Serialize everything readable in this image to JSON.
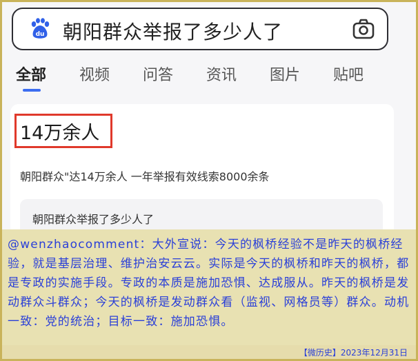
{
  "search": {
    "query": "朝阳群众举报了多少人了",
    "logo_icon": "baidu-paw-icon",
    "camera_icon": "camera-icon"
  },
  "tabs": [
    {
      "label": "全部",
      "active": true
    },
    {
      "label": "视频"
    },
    {
      "label": "问答"
    },
    {
      "label": "资讯"
    },
    {
      "label": "图片"
    },
    {
      "label": "贴吧"
    }
  ],
  "result": {
    "answer": "14万余人",
    "subtitle": "朝阳群众\"达14万余人 一年举报有效线索8000余条",
    "related_query": "朝阳群众举报了多少人了",
    "highlight_color": "#e0392b"
  },
  "comment": {
    "text": "@wenzhaocomment：大外宣说：今天的枫桥经验不是昨天的枫桥经验，就是基层治理、维护治安云云。实际是今天的枫桥和昨天的枫桥，都是专政的实施手段。专政的本质是施加恐惧、达成服从。昨天的枫桥是发动群众斗群众；今天的枫桥是发动群众看（监视、网格员等）群众。动机一致：党的统治；目标一致：施加恐惧。"
  },
  "footer": {
    "text": "【微历史】2023年12月31日"
  },
  "colors": {
    "accent": "#3c6df0",
    "comment_text": "#2a3fd8",
    "frame": "#c9b35a"
  }
}
